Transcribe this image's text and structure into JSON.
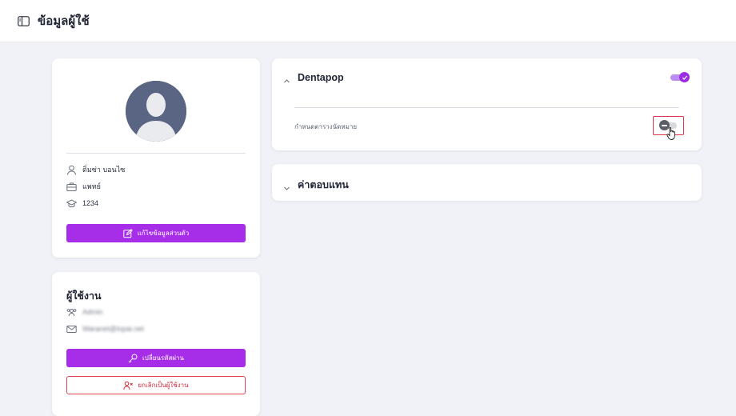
{
  "header": {
    "title": "ข้อมูลผู้ใช้",
    "sidebar_toggle_icon": "sidebar-panel-icon"
  },
  "profile": {
    "name": "ดิ่มซ่า บอนไซ",
    "role": "แพทย์",
    "code": "1234",
    "edit_button_label": "แก้ไขข้อมูลส่วนตัว"
  },
  "users": {
    "title": "ผู้ใช้งาน",
    "username": "Admin",
    "email": "Waranet@lopai.net",
    "change_password_label": "เปลี่ยนรหัสผ่าน",
    "remove_user_label": "ยกเลิกเป็นผู้ใช้งาน"
  },
  "dentapop": {
    "title": "Dentapop",
    "enabled": true,
    "setting_label": "กำหนดตารางนัดหมาย",
    "setting_enabled": false
  },
  "reply": {
    "title": "ค่าตอบแทน"
  },
  "colors": {
    "accent": "#a62ee8",
    "danger": "#e0344a",
    "background": "#f0f2f7"
  }
}
